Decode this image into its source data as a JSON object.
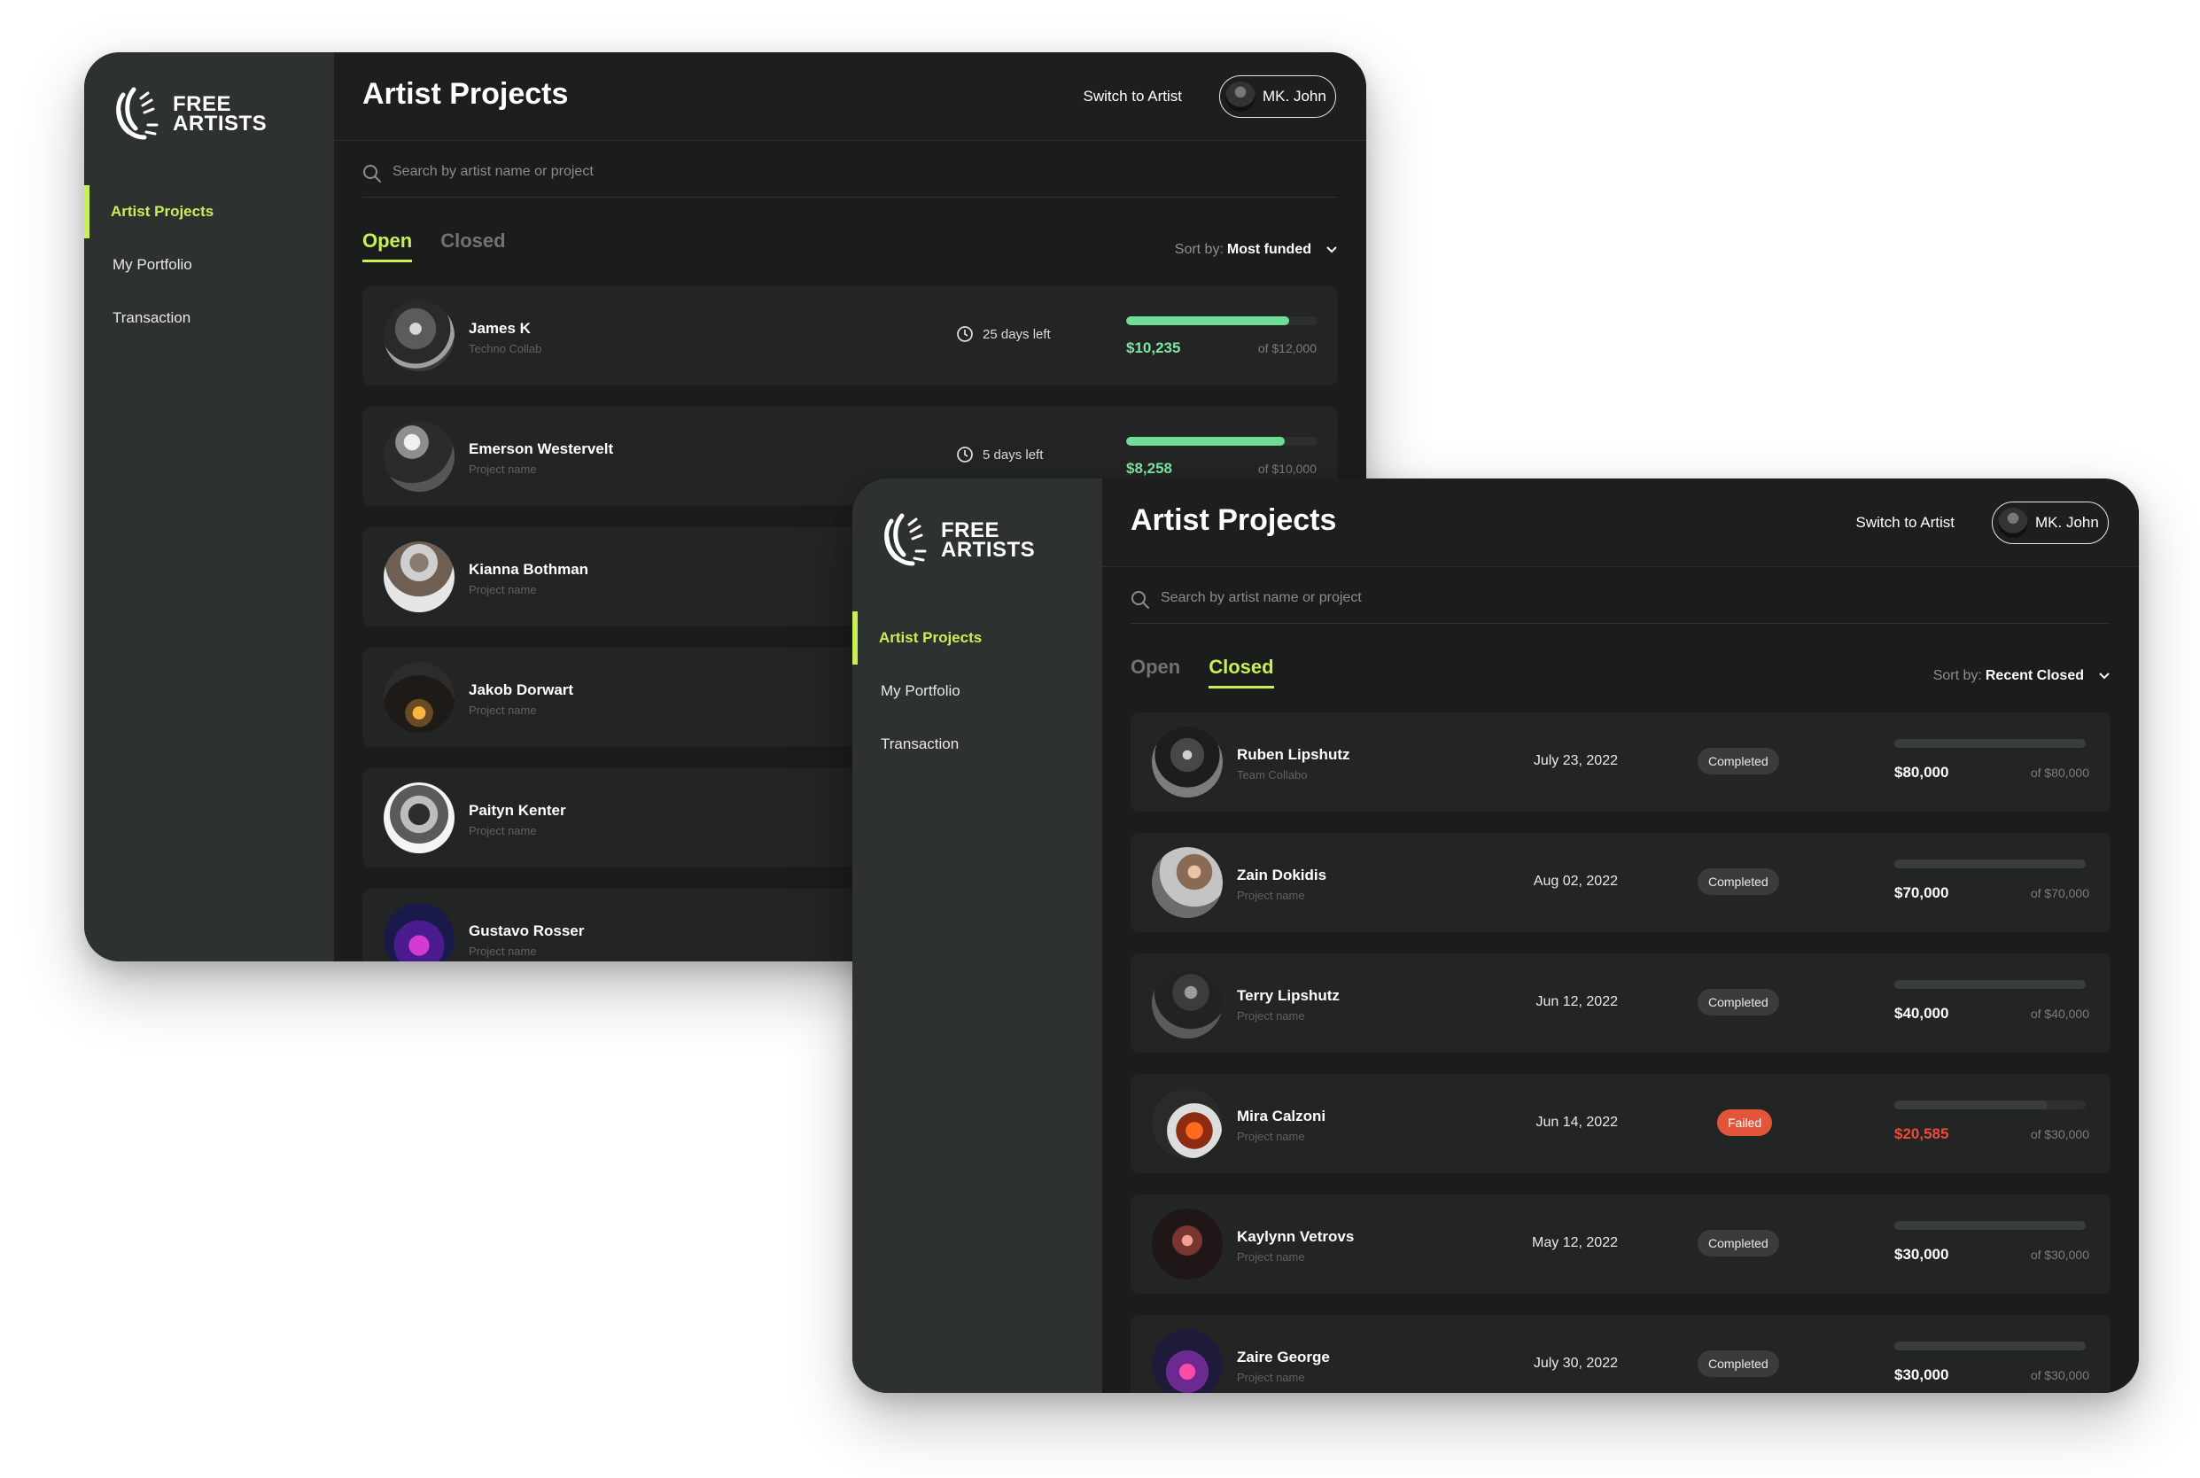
{
  "colors": {
    "accent": "#c9f053",
    "funded_green": "#6fdd98",
    "failed_red": "#e2553a",
    "sidebar": "#2d3130",
    "background": "#1b1c1c"
  },
  "brand": {
    "line1": "FRE",
    "line1_logo_glyph": "E",
    "line2": "ARTISTS",
    "icon": "wing-logo-icon"
  },
  "nav": [
    "Artist Projects",
    "My Portfolio",
    "Transaction"
  ],
  "header": {
    "title": "Artist Projects",
    "switch_label": "Switch to Artist",
    "user_name": "MK. John"
  },
  "search": {
    "placeholder": "Search by artist name or project"
  },
  "tabs": [
    "Open",
    "Closed"
  ],
  "sort_label": "Sort by:",
  "open_view": {
    "sort_value": "Most funded",
    "projects": [
      {
        "name": "James K",
        "subtitle": "Techno Collab",
        "days_left": "25 days left",
        "raised": "$10,235",
        "goal": "of $12,000",
        "progress": 0.85
      },
      {
        "name": "Emerson Westervelt",
        "subtitle": "Project name",
        "days_left": "5 days left",
        "raised": "$8,258",
        "goal": "of $10,000",
        "progress": 0.83
      },
      {
        "name": "Kianna Bothman",
        "subtitle": "Project name"
      },
      {
        "name": "Jakob Dorwart",
        "subtitle": "Project name"
      },
      {
        "name": "Paityn Kenter",
        "subtitle": "Project name"
      },
      {
        "name": "Gustavo Rosser",
        "subtitle": "Project name"
      }
    ]
  },
  "closed_view": {
    "sort_value": "Recent Closed",
    "projects": [
      {
        "name": "Ruben Lipshutz",
        "subtitle": "Team Collabo",
        "date": "July 23, 2022",
        "status": "Completed",
        "raised": "$80,000",
        "goal": "of $80,000",
        "progress": 1.0
      },
      {
        "name": "Zain Dokidis",
        "subtitle": "Project name",
        "date": "Aug 02, 2022",
        "status": "Completed",
        "raised": "$70,000",
        "goal": "of $70,000",
        "progress": 1.0
      },
      {
        "name": "Terry Lipshutz",
        "subtitle": "Project name",
        "date": "Jun 12, 2022",
        "status": "Completed",
        "raised": "$40,000",
        "goal": "of $40,000",
        "progress": 1.0
      },
      {
        "name": "Mira Calzoni",
        "subtitle": "Project name",
        "date": "Jun 14, 2022",
        "status": "Failed",
        "raised": "$20,585",
        "goal": "of $30,000",
        "progress": 0.8
      },
      {
        "name": "Kaylynn Vetrovs",
        "subtitle": "Project name",
        "date": "May 12, 2022",
        "status": "Completed",
        "raised": "$30,000",
        "goal": "of $30,000",
        "progress": 1.0
      },
      {
        "name": "Zaire George",
        "subtitle": "Project name",
        "date": "July 30, 2022",
        "status": "Completed",
        "raised": "$30,000",
        "goal": "of $30,000",
        "progress": 1.0
      }
    ]
  }
}
